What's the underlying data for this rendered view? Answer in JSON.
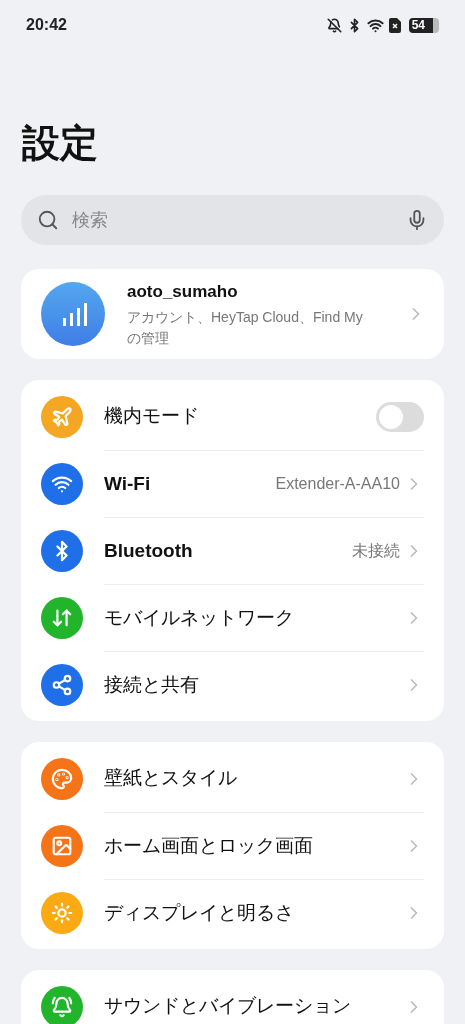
{
  "status_bar": {
    "time": "20:42",
    "battery": "54"
  },
  "title": "設定",
  "search": {
    "placeholder": "検索"
  },
  "account": {
    "name": "aoto_sumaho",
    "description": "アカウント、HeyTap Cloud、Find My の管理"
  },
  "groups": [
    {
      "items": [
        {
          "kind": "toggle",
          "label": "機内モード",
          "color": "#f5a623",
          "on": false
        },
        {
          "kind": "link",
          "label": "Wi-Fi",
          "color": "#1f6fe8",
          "value": "Extender-A-AA10"
        },
        {
          "kind": "link",
          "label": "Bluetooth",
          "color": "#1f6fe8",
          "value": "未接続"
        },
        {
          "kind": "link",
          "label": "モバイルネットワーク",
          "color": "#22b52c"
        },
        {
          "kind": "link",
          "label": "接続と共有",
          "color": "#1f6fe8"
        }
      ]
    },
    {
      "items": [
        {
          "kind": "link",
          "label": "壁紙とスタイル",
          "color": "#f57418"
        },
        {
          "kind": "link",
          "label": "ホーム画面とロック画面",
          "color": "#f57418"
        },
        {
          "kind": "link",
          "label": "ディスプレイと明るさ",
          "color": "#fcaa14"
        }
      ]
    },
    {
      "items": [
        {
          "kind": "link",
          "label": "サウンドとバイブレーション",
          "color": "#22b52c"
        }
      ]
    }
  ]
}
